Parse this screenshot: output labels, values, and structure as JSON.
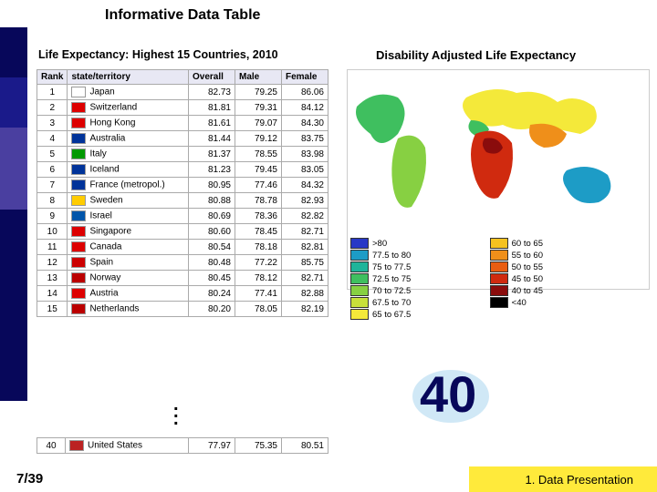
{
  "title": "Informative Data Table",
  "subtitle_left": "Life Expectancy: Highest 15 Countries, 2010",
  "subtitle_right": "Disability Adjusted Life Expectancy",
  "headers": {
    "rank": "Rank",
    "st": "state/territory",
    "o": "Overall",
    "m": "Male",
    "f": "Female"
  },
  "rows": [
    {
      "rank": "1",
      "flag": "#fff",
      "country": "Japan",
      "o": "82.73",
      "m": "79.25",
      "f": "86.06"
    },
    {
      "rank": "2",
      "flag": "#d00",
      "country": "Switzerland",
      "o": "81.81",
      "m": "79.31",
      "f": "84.12"
    },
    {
      "rank": "3",
      "flag": "#d00",
      "country": "Hong Kong",
      "o": "81.61",
      "m": "79.07",
      "f": "84.30"
    },
    {
      "rank": "4",
      "flag": "#039",
      "country": "Australia",
      "o": "81.44",
      "m": "79.12",
      "f": "83.75"
    },
    {
      "rank": "5",
      "flag": "#090",
      "country": "Italy",
      "o": "81.37",
      "m": "78.55",
      "f": "83.98"
    },
    {
      "rank": "6",
      "flag": "#039",
      "country": "Iceland",
      "o": "81.23",
      "m": "79.45",
      "f": "83.05"
    },
    {
      "rank": "7",
      "flag": "#039",
      "country": "France (metropol.)",
      "o": "80.95",
      "m": "77.46",
      "f": "84.32"
    },
    {
      "rank": "8",
      "flag": "#fc0",
      "country": "Sweden",
      "o": "80.88",
      "m": "78.78",
      "f": "82.93"
    },
    {
      "rank": "9",
      "flag": "#05a",
      "country": "Israel",
      "o": "80.69",
      "m": "78.36",
      "f": "82.82"
    },
    {
      "rank": "10",
      "flag": "#d00",
      "country": "Singapore",
      "o": "80.60",
      "m": "78.45",
      "f": "82.71"
    },
    {
      "rank": "11",
      "flag": "#d00",
      "country": "Canada",
      "o": "80.54",
      "m": "78.18",
      "f": "82.81"
    },
    {
      "rank": "12",
      "flag": "#c00",
      "country": "Spain",
      "o": "80.48",
      "m": "77.22",
      "f": "85.75"
    },
    {
      "rank": "13",
      "flag": "#b00",
      "country": "Norway",
      "o": "80.45",
      "m": "78.12",
      "f": "82.71"
    },
    {
      "rank": "14",
      "flag": "#d00",
      "country": "Austria",
      "o": "80.24",
      "m": "77.41",
      "f": "82.88"
    },
    {
      "rank": "15",
      "flag": "#b00",
      "country": "Netherlands",
      "o": "80.20",
      "m": "78.05",
      "f": "82.19"
    }
  ],
  "us_row": {
    "rank": "40",
    "flag": "#b22",
    "country": "United States",
    "o": "77.97",
    "m": "75.35",
    "f": "80.51"
  },
  "legend_left": [
    {
      "c": "#2838c6",
      "t": ">80"
    },
    {
      "c": "#1d9cc6",
      "t": "77.5 to 80"
    },
    {
      "c": "#1fb49a",
      "t": "75 to 77.5"
    },
    {
      "c": "#3fbf5f",
      "t": "72.5 to 75"
    },
    {
      "c": "#87d042",
      "t": "70 to 72.5"
    },
    {
      "c": "#c8e03a",
      "t": "67.5 to 70"
    },
    {
      "c": "#f4e93a",
      "t": "65 to 67.5"
    }
  ],
  "legend_right": [
    {
      "c": "#f6c21f",
      "t": "60 to 65"
    },
    {
      "c": "#ef8f1a",
      "t": "55 to 60"
    },
    {
      "c": "#e95d12",
      "t": "50 to 55"
    },
    {
      "c": "#d02a0f",
      "t": "45 to 50"
    },
    {
      "c": "#8a0c0c",
      "t": "40 to 45"
    },
    {
      "c": "#000000",
      "t": "<40"
    }
  ],
  "big": "40",
  "page": "7/39",
  "section": "1. Data Presentation",
  "chart_data": {
    "type": "table",
    "title": "Life Expectancy: Highest 15 Countries, 2010",
    "columns": [
      "Rank",
      "state/territory",
      "Overall",
      "Male",
      "Female"
    ],
    "rows": [
      [
        1,
        "Japan",
        82.73,
        79.25,
        86.06
      ],
      [
        2,
        "Switzerland",
        81.81,
        79.31,
        84.12
      ],
      [
        3,
        "Hong Kong",
        81.61,
        79.07,
        84.3
      ],
      [
        4,
        "Australia",
        81.44,
        79.12,
        83.75
      ],
      [
        5,
        "Italy",
        81.37,
        78.55,
        83.98
      ],
      [
        6,
        "Iceland",
        81.23,
        79.45,
        83.05
      ],
      [
        7,
        "France (metropol.)",
        80.95,
        77.46,
        84.32
      ],
      [
        8,
        "Sweden",
        80.88,
        78.78,
        82.93
      ],
      [
        9,
        "Israel",
        80.69,
        78.36,
        82.82
      ],
      [
        10,
        "Singapore",
        80.6,
        78.45,
        82.71
      ],
      [
        11,
        "Canada",
        80.54,
        78.18,
        82.81
      ],
      [
        12,
        "Spain",
        80.48,
        77.22,
        85.75
      ],
      [
        13,
        "Norway",
        80.45,
        78.12,
        82.71
      ],
      [
        14,
        "Austria",
        80.24,
        77.41,
        82.88
      ],
      [
        15,
        "Netherlands",
        80.2,
        78.05,
        82.19
      ],
      [
        40,
        "United States",
        77.97,
        75.35,
        80.51
      ]
    ]
  }
}
